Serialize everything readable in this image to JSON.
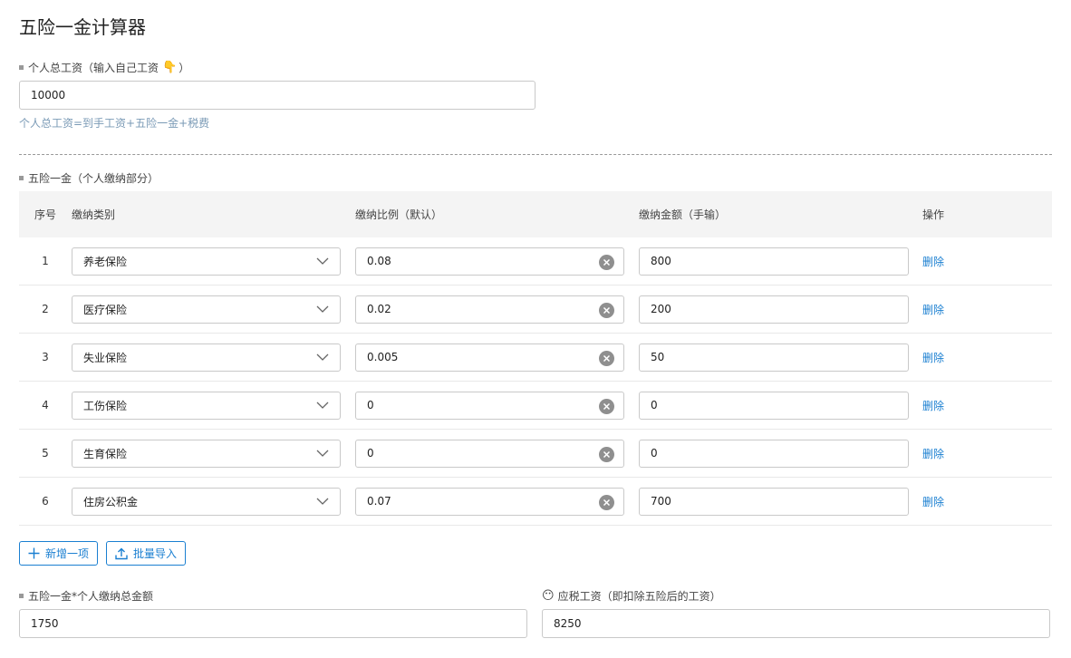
{
  "title": "五险一金计算器",
  "salary": {
    "label": "个人总工资（输入自己工资",
    "label_emoji": "👇",
    "label_suffix": "）",
    "value": "10000",
    "hint": "个人总工资=到手工资+五险一金+税费"
  },
  "insurance": {
    "label": "五险一金（个人缴纳部分）",
    "headers": {
      "index": "序号",
      "type": "缴纳类别",
      "ratio": "缴纳比例（默认）",
      "amount": "缴纳金额（手输）",
      "op": "操作"
    },
    "rows": [
      {
        "index": "1",
        "type": "养老保险",
        "ratio": "0.08",
        "amount": "800",
        "op": "删除"
      },
      {
        "index": "2",
        "type": "医疗保险",
        "ratio": "0.02",
        "amount": "200",
        "op": "删除"
      },
      {
        "index": "3",
        "type": "失业保险",
        "ratio": "0.005",
        "amount": "50",
        "op": "删除"
      },
      {
        "index": "4",
        "type": "工伤保险",
        "ratio": "0",
        "amount": "0",
        "op": "删除"
      },
      {
        "index": "5",
        "type": "生育保险",
        "ratio": "0",
        "amount": "0",
        "op": "删除"
      },
      {
        "index": "6",
        "type": "住房公积金",
        "ratio": "0.07",
        "amount": "700",
        "op": "删除"
      }
    ],
    "add_label": "新增一项",
    "import_label": "批量导入"
  },
  "total": {
    "label": "五险一金*个人缴纳总金额",
    "value": "1750"
  },
  "taxable": {
    "emoji": "😶",
    "label": "应税工资（即扣除五险后的工资）",
    "value": "8250"
  },
  "icons": {
    "chevron": "chevron-down-icon",
    "clear": "clear-circle-icon",
    "plus": "plus-icon",
    "upload": "upload-icon"
  },
  "colors": {
    "link": "#1a7fd1",
    "hint": "#7a9ab6"
  }
}
